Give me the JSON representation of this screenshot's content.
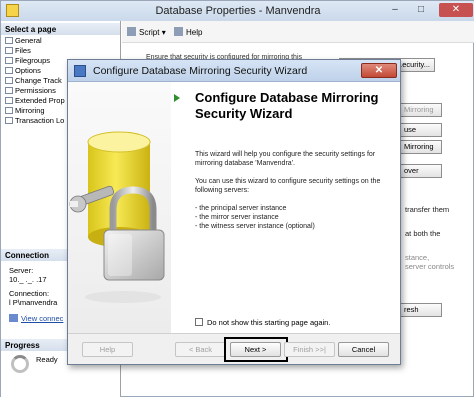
{
  "window": {
    "title": "Database Properties - Manvendra",
    "minimize": "–",
    "maximize": "□",
    "close": "✕"
  },
  "left_pane": {
    "select_page_header": "Select a page",
    "pages": [
      "General",
      "Files",
      "Filegroups",
      "Options",
      "Change Track",
      "Permissions",
      "Extended Prop",
      "Mirroring",
      "Transaction Lo"
    ],
    "connection_header": "Connection",
    "server_label": "Server:",
    "server_value": "10._ ._. .17",
    "connection_label": "Connection:",
    "connection_value": "l      P\\manvendra",
    "view_connection_link": "View connec",
    "progress_header": "Progress",
    "progress_status": "Ready"
  },
  "toolbar": {
    "script_label": "Script",
    "script_dropdown": "▾",
    "help_label": "Help"
  },
  "background_content": {
    "description": "Ensure that security is configured for mirroring this",
    "configure_security_button": "...ecurity...",
    "side_buttons": [
      "Mirroring",
      "use",
      "Mirroring",
      "over",
      "resh"
    ],
    "side_texts": [
      "transfer them",
      "at both the",
      "stance,",
      "server controls"
    ]
  },
  "wizard": {
    "title": "Configure Database Mirroring Security Wizard",
    "close": "✕",
    "heading": "Configure Database Mirroring Security Wizard",
    "paragraph1": "This wizard will help you configure the security settings for mirroring database 'Manvendra'.",
    "paragraph2": "You can use this wizard to configure security settings on the following servers:",
    "servers": [
      "- the principal server instance",
      "- the mirror server instance",
      "- the witness server instance (optional)"
    ],
    "dont_show_label": "Do not show this starting page again.",
    "dont_show_checked": false,
    "buttons": {
      "help": "Help",
      "back": "< Back",
      "next": "Next >",
      "finish": "Finish >>|",
      "cancel": "Cancel"
    }
  },
  "colors": {
    "title_gradient_top": "#d6e4f5",
    "close_red": "#c24a35",
    "arrow_green": "#2d8f2d",
    "cylinder_yellow": "#f2dc2e",
    "link_blue": "#1f4ea6"
  },
  "icons": [
    "database-icon",
    "wizard-icon",
    "page-icon",
    "script-icon",
    "help-icon",
    "connection-icon",
    "progress-icon",
    "green-arrow-icon",
    "database-cylinder-art",
    "padlock-art",
    "wrench-art"
  ]
}
